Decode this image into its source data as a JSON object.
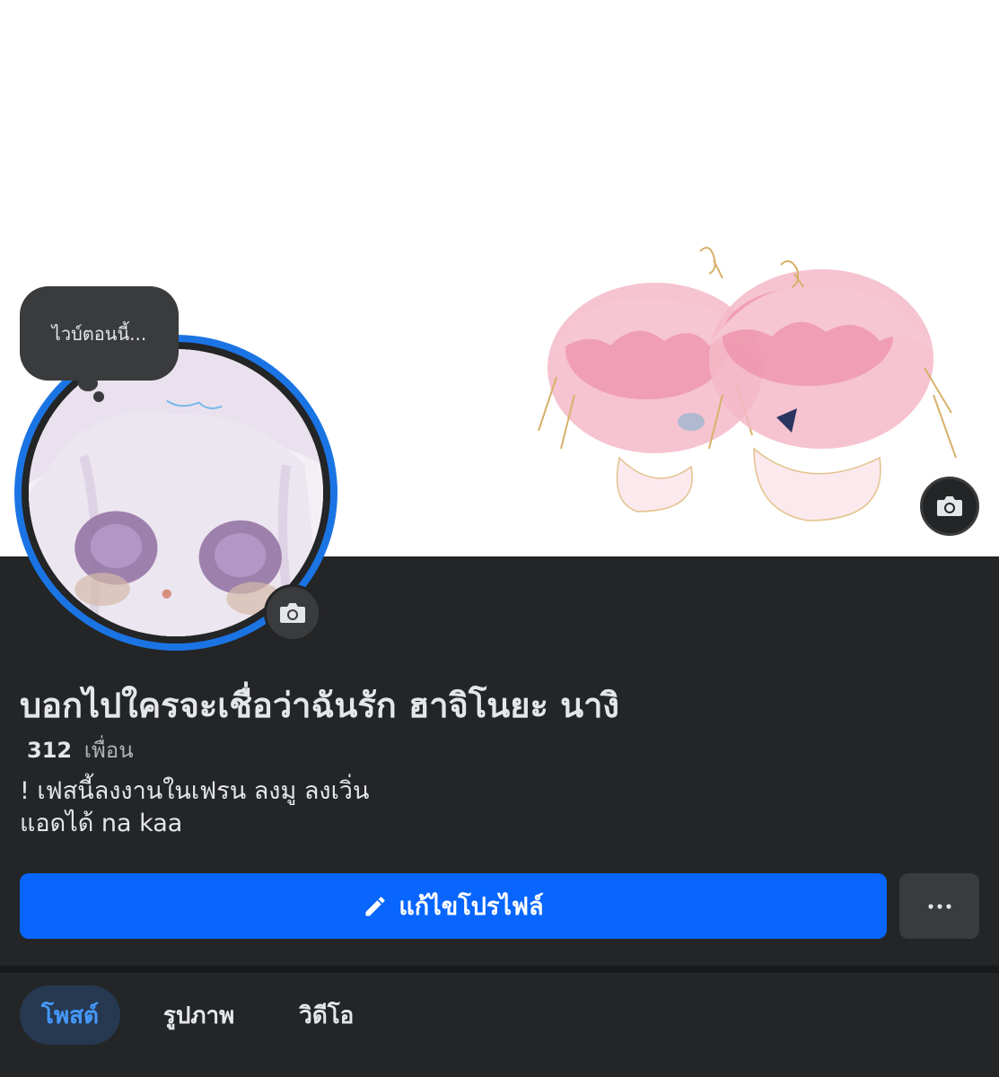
{
  "cover": {
    "camera_icon": "camera-icon"
  },
  "note": {
    "text": "ไวบ์ตอนนี้..."
  },
  "profile": {
    "name": "บอกไปใครจะเชื่อว่าฉันรัก ฮาจิโนยะ นางิ",
    "friends_count": "312",
    "friends_label": "เพื่อน",
    "bio_line1": "! เฟสนี้ลงงานในเฟรน ลงมู ลงเวิ่น",
    "bio_line2": "แอดได้ na kaa",
    "camera_icon": "camera-icon"
  },
  "actions": {
    "edit_label": "แก้ไขโปรไฟล์",
    "edit_icon": "pencil-icon",
    "more_icon": "more-dots-icon"
  },
  "tabs": [
    {
      "label": "โพสต์",
      "active": true
    },
    {
      "label": "รูปภาพ",
      "active": false
    },
    {
      "label": "วิดีโอ",
      "active": false
    }
  ],
  "colors": {
    "background": "#242526",
    "accent": "#0866ff",
    "avatar_ring": "#1b74e4",
    "tab_active_bg": "#263951",
    "tab_active_text": "#4599ff"
  }
}
